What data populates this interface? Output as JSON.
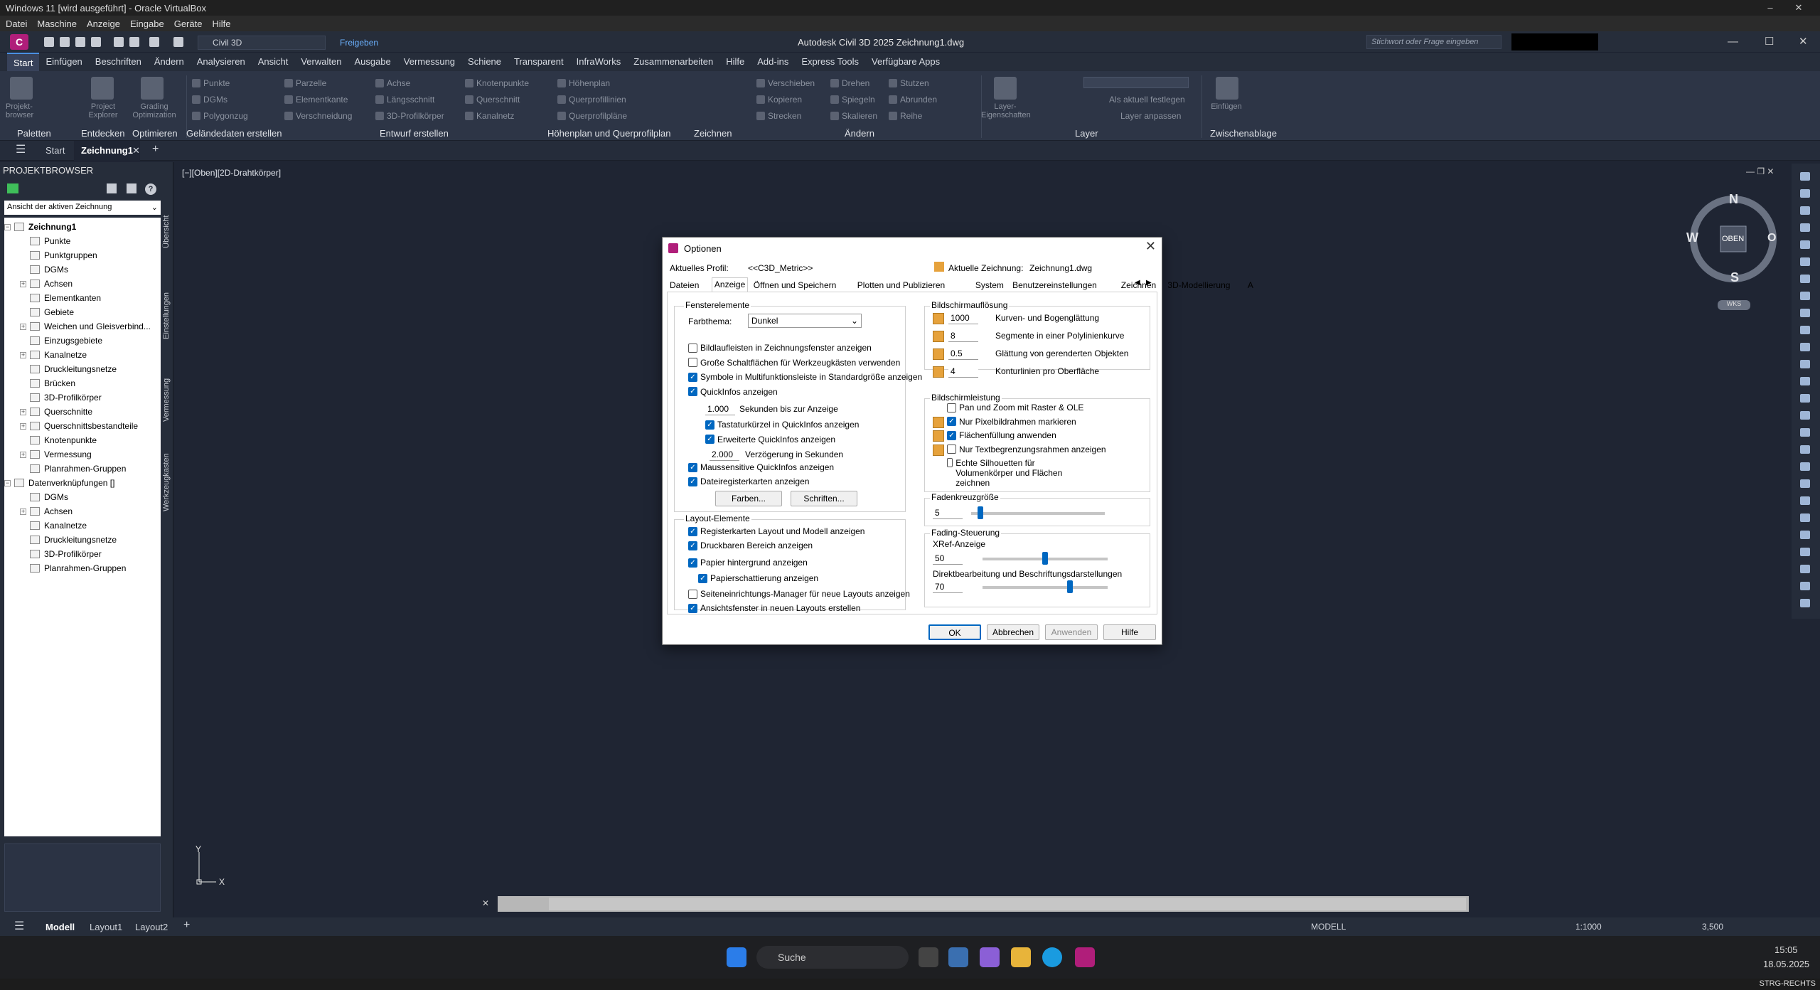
{
  "vbox": {
    "title": "Windows 11 [wird ausgeführt] - Oracle VirtualBox",
    "menu": [
      "Datei",
      "Maschine",
      "Anzeige",
      "Eingabe",
      "Geräte",
      "Hilfe"
    ]
  },
  "app": {
    "logo": "C",
    "workspace": "Civil 3D",
    "share": "Freigeben",
    "title": "Autodesk Civil 3D 2025   Zeichnung1.dwg",
    "search_placeholder": "Stichwort oder Frage eingeben"
  },
  "ribbon_tabs": [
    "Start",
    "Einfügen",
    "Beschriften",
    "Ändern",
    "Analysieren",
    "Ansicht",
    "Verwalten",
    "Ausgabe",
    "Vermessung",
    "Schiene",
    "Transparent",
    "InfraWorks",
    "Zusammenarbeiten",
    "Hilfe",
    "Add-ins",
    "Express Tools",
    "Verfügbare Apps"
  ],
  "ribbon": {
    "big": [
      "Projekt-browser",
      "Project Explorer",
      "Grading Optimization",
      "Layer-Eigenschaften",
      "Einfügen"
    ],
    "items": [
      "Punkte",
      "DGMs",
      "Polygonzug",
      "Parzelle",
      "Elementkante",
      "Verschneidung",
      "Achse",
      "Längsschnitt",
      "3D-Profilkörper",
      "Knotenpunkte",
      "Querschnitt",
      "Kanalnetz",
      "Höhenplan",
      "Querprofillinien",
      "Querprofilpläne",
      "Verschieben",
      "Kopieren",
      "Strecken",
      "Drehen",
      "Spiegeln",
      "Skalieren",
      "Stutzen",
      "Abrunden",
      "Reihe",
      "Als aktuell festlegen",
      "Layer anpassen"
    ],
    "panels": [
      "Paletten",
      "Entdecken",
      "Optimieren",
      "Geländedaten erstellen",
      "Entwurf erstellen",
      "Höhenplan und Querprofilplan",
      "Zeichnen",
      "Ändern",
      "Layer",
      "Zwischenablage"
    ]
  },
  "doctabs": {
    "start": "Start",
    "active": "Zeichnung1",
    "view_label": "[−][Oben][2D-Drahtkörper]"
  },
  "browser": {
    "title": "PROJEKTBROWSER",
    "dropdown": "Ansicht der aktiven Zeichnung",
    "tree": [
      {
        "label": "Zeichnung1",
        "lvl": 0,
        "exp": "−",
        "bold": true
      },
      {
        "label": "Punkte",
        "lvl": 1
      },
      {
        "label": "Punktgruppen",
        "lvl": 1
      },
      {
        "label": "DGMs",
        "lvl": 1
      },
      {
        "label": "Achsen",
        "lvl": 1,
        "exp": "+"
      },
      {
        "label": "Elementkanten",
        "lvl": 1
      },
      {
        "label": "Gebiete",
        "lvl": 1
      },
      {
        "label": "Weichen und Gleisverbind...",
        "lvl": 1,
        "exp": "+"
      },
      {
        "label": "Einzugsgebiete",
        "lvl": 1
      },
      {
        "label": "Kanalnetze",
        "lvl": 1,
        "exp": "+"
      },
      {
        "label": "Druckleitungsnetze",
        "lvl": 1
      },
      {
        "label": "Brücken",
        "lvl": 1
      },
      {
        "label": "3D-Profilkörper",
        "lvl": 1
      },
      {
        "label": "Querschnitte",
        "lvl": 1,
        "exp": "+"
      },
      {
        "label": "Querschnittsbestandteile",
        "lvl": 1,
        "exp": "+"
      },
      {
        "label": "Knotenpunkte",
        "lvl": 1
      },
      {
        "label": "Vermessung",
        "lvl": 1,
        "exp": "+"
      },
      {
        "label": "Planrahmen-Gruppen",
        "lvl": 1
      },
      {
        "label": "Datenverknüpfungen []",
        "lvl": 0,
        "exp": "−"
      },
      {
        "label": "DGMs",
        "lvl": 1
      },
      {
        "label": "Achsen",
        "lvl": 1,
        "exp": "+"
      },
      {
        "label": "Kanalnetze",
        "lvl": 1
      },
      {
        "label": "Druckleitungsnetze",
        "lvl": 1
      },
      {
        "label": "3D-Profilkörper",
        "lvl": 1
      },
      {
        "label": "Planrahmen-Gruppen",
        "lvl": 1
      }
    ],
    "vtabs": [
      "Übersicht",
      "Einstellungen",
      "Vermessung",
      "Werkzeugkasten"
    ]
  },
  "viewcube": {
    "n": "N",
    "s": "S",
    "w": "W",
    "o": "O",
    "center": "OBEN",
    "wcs": "WKS"
  },
  "layout_tabs": [
    "Modell",
    "Layout1",
    "Layout2"
  ],
  "status": {
    "model": "MODELL",
    "scale": "1:1000",
    "lw": "3,500"
  },
  "taskbar": {
    "search": "Suche",
    "time": "15:05",
    "date": "18.05.2025"
  },
  "vbstatus": "STRG-RECHTS",
  "dialog": {
    "title": "Optionen",
    "profile_label": "Aktuelles Profil:",
    "profile": "<<C3D_Metric>>",
    "drawing_label": "Aktuelle Zeichnung:",
    "drawing": "Zeichnung1.dwg",
    "tabs": [
      "Dateien",
      "Anzeige",
      "Öffnen und Speichern",
      "Plotten und Publizieren",
      "System",
      "Benutzereinstellungen",
      "Zeichnen",
      "3D-Modellierung",
      "A"
    ],
    "fenster": {
      "title": "Fensterelemente",
      "farbthema_label": "Farbthema:",
      "farbthema": "Dunkel",
      "checks": [
        {
          "l": "Bildlaufleisten in Zeichnungsfenster anzeigen",
          "on": false
        },
        {
          "l": "Große Schaltflächen für Werkzeugkästen verwenden",
          "on": false
        },
        {
          "l": "Symbole in Multifunktionsleiste in Standardgröße anzeigen",
          "on": true
        },
        {
          "l": "QuickInfos anzeigen",
          "on": true
        }
      ],
      "sec_val": "1.000",
      "sec_label": "Sekunden bis zur Anzeige",
      "sub": [
        {
          "l": "Tastaturkürzel in QuickInfos anzeigen",
          "on": true
        },
        {
          "l": "Erweiterte QuickInfos anzeigen",
          "on": true
        }
      ],
      "delay_val": "2.000",
      "delay_label": "Verzögerung in Sekunden",
      "checks2": [
        {
          "l": "Maussensitive QuickInfos anzeigen",
          "on": true
        },
        {
          "l": "Dateiregisterkarten anzeigen",
          "on": true
        }
      ],
      "btn_colors": "Farben...",
      "btn_fonts": "Schriften..."
    },
    "layout": {
      "title": "Layout-Elemente",
      "checks": [
        {
          "l": "Registerkarten Layout und Modell anzeigen",
          "on": true
        },
        {
          "l": "Druckbaren Bereich anzeigen",
          "on": true
        },
        {
          "l": "Papier hintergrund anzeigen",
          "on": true
        },
        {
          "l": "Papierschattierung anzeigen",
          "on": true,
          "indent": true
        },
        {
          "l": "Seiteneinrichtungs-Manager für neue Layouts anzeigen",
          "on": false
        },
        {
          "l": "Ansichtsfenster in neuen Layouts erstellen",
          "on": true
        }
      ]
    },
    "aufl": {
      "title": "Bildschirmauflösung",
      "rows": [
        {
          "v": "1000",
          "l": "Kurven- und Bogenglättung"
        },
        {
          "v": "8",
          "l": "Segmente in einer Polylinienkurve"
        },
        {
          "v": "0.5",
          "l": "Glättung von gerenderten Objekten"
        },
        {
          "v": "4",
          "l": "Konturlinien pro Oberfläche"
        }
      ]
    },
    "leist": {
      "title": "Bildschirmleistung",
      "checks": [
        {
          "l": "Pan und Zoom mit Raster & OLE",
          "on": false
        },
        {
          "l": "Nur Pixelbildrahmen markieren",
          "on": true
        },
        {
          "l": "Flächenfüllung anwenden",
          "on": true
        },
        {
          "l": "Nur Textbegrenzungsrahmen anzeigen",
          "on": false
        },
        {
          "l": "Echte Silhouetten für Volumenkörper und Flächen zeichnen",
          "on": false
        }
      ]
    },
    "cross": {
      "title": "Fadenkreuzgröße",
      "v": "5",
      "level": 0.05
    },
    "fading": {
      "title": "Fading-Steuerung",
      "xref_label": "XRef-Anzeige",
      "xref": "50",
      "xref_level": 0.5,
      "edit_label": "Direktbearbeitung und Beschriftungsdarstellungen",
      "edit": "70",
      "edit_level": 0.7
    },
    "buttons": {
      "ok": "OK",
      "cancel": "Abbrechen",
      "apply": "Anwenden",
      "help": "Hilfe"
    }
  }
}
